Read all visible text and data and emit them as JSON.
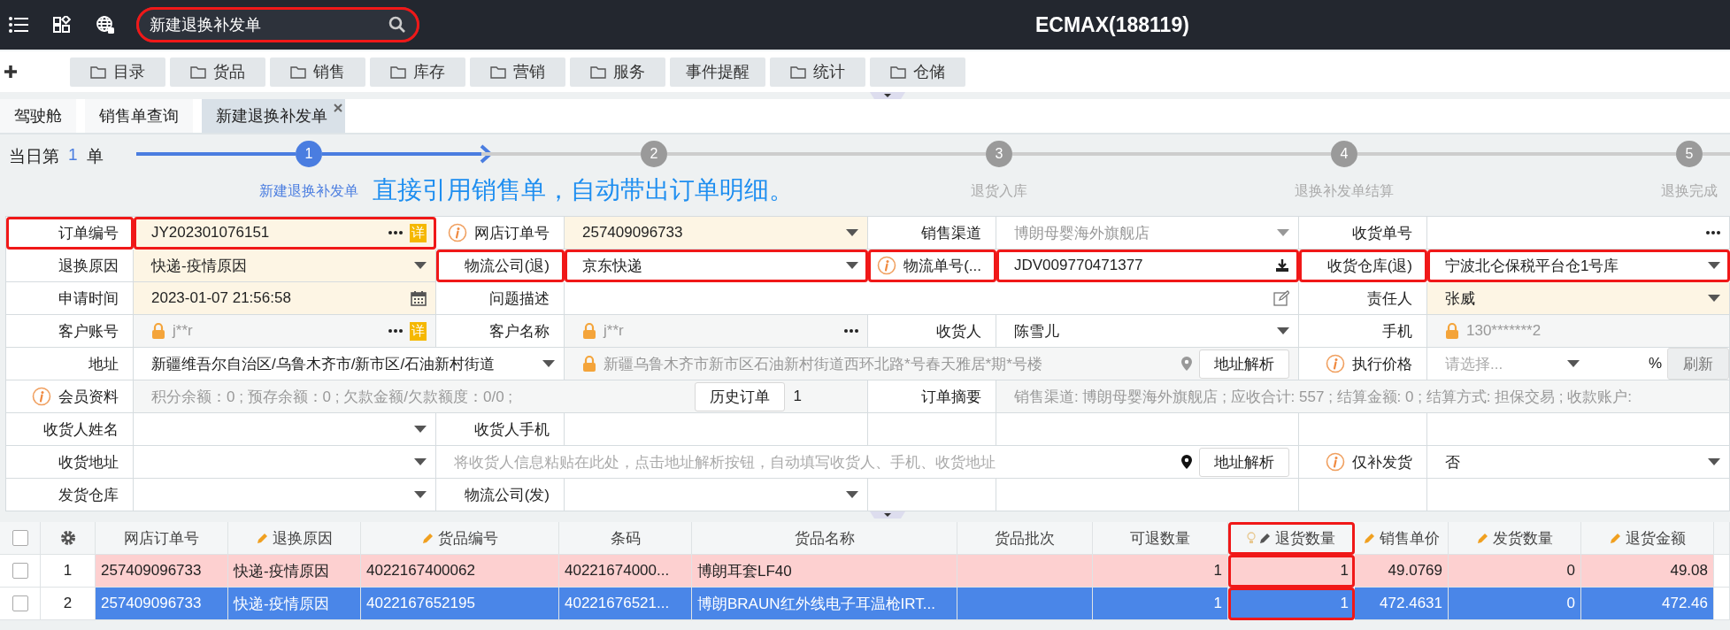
{
  "topbar": {
    "search": {
      "value": "新建退换补发单",
      "highlight": true
    },
    "title": "ECMAX(188119)"
  },
  "nav": [
    {
      "label": "目录",
      "kind": "folder"
    },
    {
      "label": "货品",
      "kind": "folder"
    },
    {
      "label": "销售",
      "kind": "folder"
    },
    {
      "label": "库存",
      "kind": "folder"
    },
    {
      "label": "营销",
      "kind": "folder"
    },
    {
      "label": "服务",
      "kind": "folder"
    },
    {
      "label": "事件提醒",
      "kind": "plain"
    },
    {
      "label": "统计",
      "kind": "folder"
    },
    {
      "label": "仓储",
      "kind": "folder"
    }
  ],
  "tabs": [
    {
      "label": "驾驶舱",
      "selected": false,
      "closable": false
    },
    {
      "label": "销售单查询",
      "selected": false,
      "closable": false
    },
    {
      "label": "新建退换补发单",
      "selected": true,
      "closable": true
    }
  ],
  "stepper": {
    "count_prefix": "当日第",
    "count": "1",
    "count_suffix": "单",
    "annotation": "直接引用销售单，自动带出订单明细。",
    "steps": [
      {
        "number": "1",
        "label": "新建退换补发单",
        "active": true
      },
      {
        "number": "2",
        "active": false
      },
      {
        "number": "3",
        "label": "退货入库",
        "active": false
      },
      {
        "number": "4",
        "label": "退换补发单结算",
        "active": false
      },
      {
        "number": "5",
        "label": "退换完成",
        "active": false
      }
    ]
  },
  "form": {
    "rows": [
      {
        "kind": "pairs",
        "fields": [
          {
            "label": "订单编号",
            "info": false,
            "value": "JY202301076151",
            "kind": "more",
            "badge": "详",
            "required": true,
            "locked": false,
            "disabled": false,
            "highlight": true
          },
          {
            "label": "网店订单号",
            "info": true,
            "value": "257409096733",
            "kind": "select",
            "required": true,
            "locked": false,
            "disabled": false,
            "highlight": false
          },
          {
            "label": "销售渠道",
            "info": false,
            "value": "博朗母婴海外旗舰店",
            "kind": "select",
            "required": false,
            "locked": false,
            "disabled": true,
            "highlight": false
          },
          {
            "label": "收货单号",
            "info": false,
            "kind": "more",
            "required": false,
            "locked": false,
            "disabled": false,
            "highlight": false
          }
        ]
      },
      {
        "kind": "pairs",
        "fields": [
          {
            "label": "退换原因",
            "info": false,
            "value": "快递-疫情原因",
            "kind": "select",
            "required": true,
            "locked": false,
            "disabled": false,
            "highlight": false
          },
          {
            "label": "物流公司(退)",
            "info": false,
            "value": "京东快递",
            "kind": "select",
            "required": false,
            "locked": false,
            "disabled": false,
            "highlight": true
          },
          {
            "label": "物流单号(...",
            "info": true,
            "value": "JDV009770471377",
            "kind": "download",
            "required": false,
            "locked": false,
            "disabled": false,
            "highlight": true
          },
          {
            "label": "收货仓库(退)",
            "info": false,
            "value": "宁波北仑保税平台仓1号库",
            "kind": "select",
            "required": false,
            "locked": false,
            "disabled": false,
            "highlight": true
          }
        ]
      },
      {
        "kind": "wide",
        "fields": [
          {
            "label": "申请时间",
            "info": false,
            "value": "2023-01-07 21:56:58",
            "kind": "date",
            "required": true,
            "locked": false,
            "disabled": false,
            "highlight": false
          },
          {
            "label": "问题描述",
            "info": false,
            "kind": "edit",
            "required": false,
            "locked": false,
            "disabled": false,
            "highlight": false
          },
          {
            "label": "责任人",
            "info": false,
            "value": "张威",
            "kind": "select",
            "required": true,
            "locked": false,
            "disabled": false,
            "highlight": false
          }
        ]
      },
      {
        "kind": "pairs",
        "fields": [
          {
            "label": "客户账号",
            "info": false,
            "value": "j**r",
            "kind": "more",
            "badge": "详",
            "required": false,
            "locked": true,
            "disabled": false,
            "highlight": false
          },
          {
            "label": "客户名称",
            "info": false,
            "value": "j**r",
            "kind": "more",
            "required": false,
            "locked": true,
            "disabled": false,
            "highlight": false
          },
          {
            "label": "收货人",
            "info": false,
            "value": "陈雪儿",
            "kind": "select",
            "required": false,
            "locked": false,
            "disabled": false,
            "highlight": false
          },
          {
            "label": "手机",
            "info": false,
            "value": "130*******2",
            "kind": "text",
            "required": false,
            "locked": true,
            "disabled": false,
            "highlight": false
          }
        ]
      },
      {
        "kind": "address",
        "label": "地址",
        "region": "新疆维吾尔自治区/乌鲁木齐市/新市区/石油新村街道",
        "detail": "新疆乌鲁木齐市新市区石油新村街道西环北路*号春天雅居*期*号楼",
        "button": "地址解析",
        "price_label": "执行价格",
        "price_placeholder": "请选择...",
        "percent": "%",
        "refresh": "刷新"
      },
      {
        "kind": "member",
        "label": "会员资料",
        "info": "积分余额：0 ; 预存余额：0 ; 欠款金额/欠款额度：0/0 ;",
        "button": "历史订单",
        "count": "1",
        "summary_label": "订单摘要",
        "summary": "销售渠道: 博朗母婴海外旗舰店 ; 应收合计: 557 ; 结算金额: 0 ; 结算方式: 担保交易 ; 收款账户:"
      },
      {
        "kind": "pairs",
        "fields": [
          {
            "label": "收货人姓名",
            "info": false,
            "kind": "select",
            "required": false,
            "locked": false,
            "disabled": false,
            "highlight": false
          },
          {
            "label": "收货人手机",
            "info": false,
            "kind": "text",
            "required": false,
            "locked": false,
            "disabled": false,
            "highlight": false
          }
        ]
      },
      {
        "kind": "receiver",
        "label": "收货地址",
        "placeholder": "将收货人信息粘贴在此处，点击地址解析按钮，自动填写收货人、手机、收货地址",
        "button": "地址解析",
        "resend_label": "仅补发货",
        "resend_value": "否"
      },
      {
        "kind": "pairs",
        "fields": [
          {
            "label": "发货仓库",
            "info": false,
            "kind": "select",
            "required": false,
            "locked": false,
            "disabled": false,
            "highlight": false
          },
          {
            "label": "物流公司(发)",
            "info": false,
            "kind": "select",
            "required": false,
            "locked": false,
            "disabled": false,
            "highlight": false
          }
        ]
      }
    ]
  },
  "table": {
    "all_checked": false,
    "columns": [
      {
        "label": "网店订单号",
        "kind": "plain",
        "numeric": false,
        "highlight": false
      },
      {
        "label": "退换原因",
        "kind": "editable",
        "numeric": false,
        "highlight": false
      },
      {
        "label": "货品编号",
        "kind": "editable",
        "numeric": false,
        "highlight": false
      },
      {
        "label": "条码",
        "kind": "plain",
        "numeric": false,
        "highlight": false
      },
      {
        "label": "货品名称",
        "kind": "plain",
        "numeric": false,
        "highlight": false
      },
      {
        "label": "货品批次",
        "kind": "plain",
        "highlight": false
      },
      {
        "label": "可退数量",
        "kind": "plain",
        "numeric": true,
        "highlight": false
      },
      {
        "label": "退货数量",
        "kind": "hinted",
        "numeric": true,
        "highlight": true
      },
      {
        "label": "销售单价",
        "kind": "editable",
        "numeric": true,
        "highlight": false
      },
      {
        "label": "发货数量",
        "kind": "editable",
        "numeric": true,
        "highlight": false
      },
      {
        "label": "退货金额",
        "kind": "editable",
        "numeric": true,
        "highlight": false
      }
    ],
    "rows": [
      {
        "number": "1",
        "checked": false,
        "selected": false,
        "flagged": true,
        "cells": [
          "257409096733",
          "快递-疫情原因",
          "4022167400062",
          "40221674000...",
          "博朗耳套LF40",
          "",
          "1",
          "1",
          "49.0769",
          "0",
          "49.08"
        ]
      },
      {
        "number": "2",
        "checked": false,
        "selected": true,
        "flagged": false,
        "cells": [
          "257409096733",
          "快递-疫情原因",
          "4022167652195",
          "40221676521...",
          "博朗BRAUN红外线电子耳温枪IRT...",
          "",
          "1",
          "1",
          "472.4631",
          "0",
          "472.46"
        ]
      }
    ]
  }
}
